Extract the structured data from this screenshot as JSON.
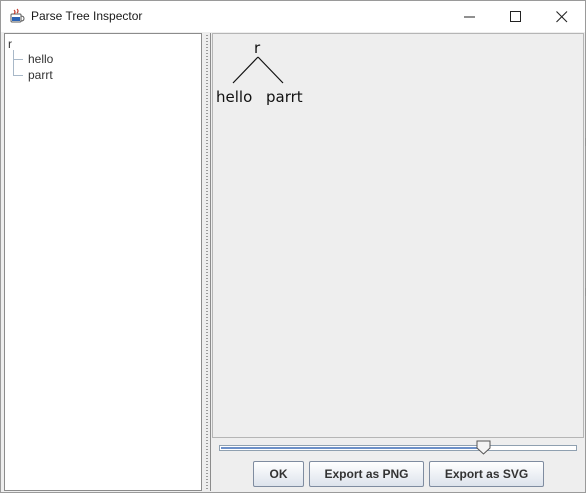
{
  "window": {
    "title": "Parse Tree Inspector",
    "icon": "java-cup-icon"
  },
  "tree": {
    "root": "r",
    "children": [
      "hello",
      "parrt"
    ]
  },
  "parse_tree_view": {
    "root_label": "r",
    "leaves": [
      "hello",
      "parrt"
    ]
  },
  "zoom_slider": {
    "level": 0.75
  },
  "buttons": {
    "ok": "OK",
    "export_png": "Export as PNG",
    "export_svg": "Export as SVG"
  },
  "colors": {
    "slider_fill": "#6d90c8",
    "panel_bg": "#eeeeee"
  }
}
